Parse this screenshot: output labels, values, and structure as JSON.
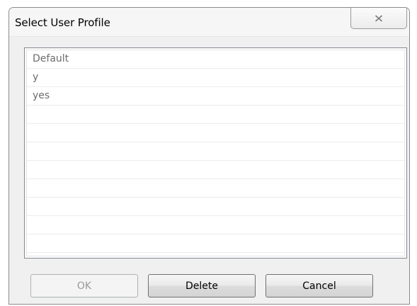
{
  "window": {
    "title": "Select User Profile",
    "close_icon": "close-icon"
  },
  "profiles": [
    "Default",
    "y",
    "yes",
    "",
    "",
    "",
    "",
    "",
    "",
    "",
    ""
  ],
  "buttons": {
    "ok": {
      "label": "OK",
      "enabled": false
    },
    "delete": {
      "label": "Delete",
      "enabled": true
    },
    "cancel": {
      "label": "Cancel",
      "enabled": true
    }
  },
  "colors": {
    "dialog_background": "#f0f0f0",
    "list_text": "#6d6d6d",
    "disabled_text": "#9a9a9a"
  }
}
